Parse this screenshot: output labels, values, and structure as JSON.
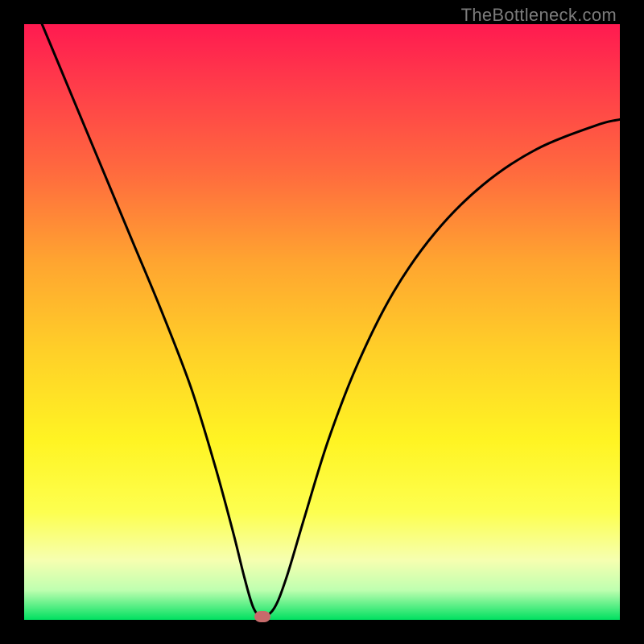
{
  "watermark": "TheBottleneck.com",
  "chart_data": {
    "type": "line",
    "title": "",
    "xlabel": "",
    "ylabel": "",
    "xlim": [
      0,
      100
    ],
    "ylim": [
      0,
      100
    ],
    "series": [
      {
        "name": "bottleneck-curve",
        "x": [
          3,
          8,
          13,
          18,
          23,
          28,
          32,
          35,
          37,
          38.5,
          40,
          42,
          44,
          47,
          51,
          56,
          62,
          69,
          77,
          86,
          96,
          100
        ],
        "y": [
          100,
          88,
          76,
          64,
          52,
          39,
          26,
          15,
          7,
          2,
          0.5,
          2,
          7,
          17,
          30,
          43,
          55,
          65,
          73,
          79,
          83,
          84
        ]
      }
    ],
    "marker": {
      "x": 40,
      "y": 0.5,
      "color": "#c76b6b"
    },
    "gradient_stops": [
      {
        "pos": 0,
        "color": "#ff1a50"
      },
      {
        "pos": 70,
        "color": "#fff423"
      },
      {
        "pos": 100,
        "color": "#00e060"
      }
    ]
  }
}
